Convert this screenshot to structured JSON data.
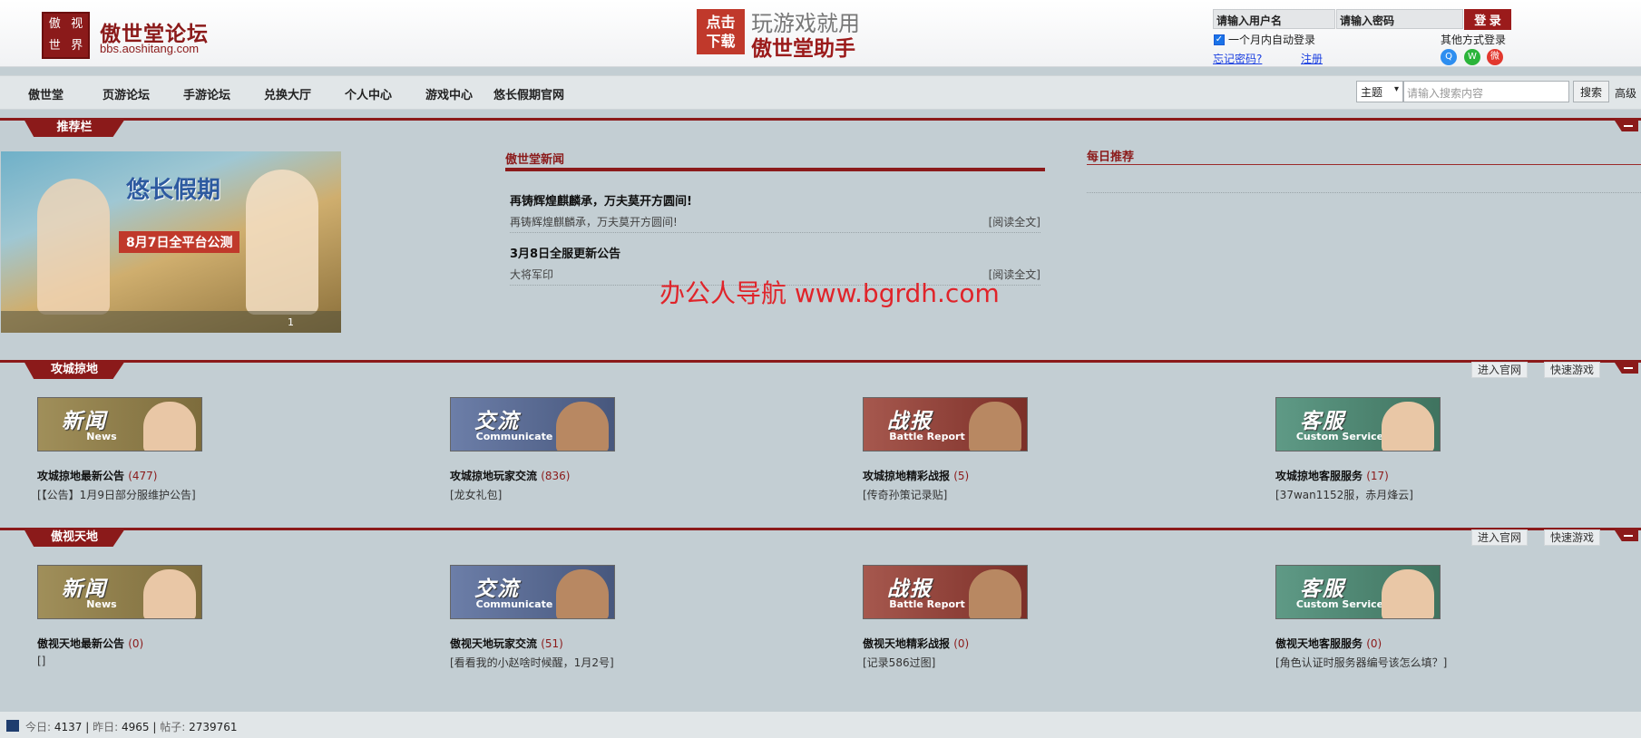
{
  "header": {
    "logo_chars": [
      "傲",
      "视",
      "世",
      "界"
    ],
    "site_name": "傲世堂论坛",
    "site_url": "bbs.aoshitang.com",
    "promo_badge": "点击下载",
    "promo_line1": "玩游戏就用",
    "promo_line2": "傲世堂助手"
  },
  "login": {
    "username_placeholder": "请输入用户名",
    "password_placeholder": "请输入密码",
    "login_button": "登 录",
    "remember_label": "一个月内自动登录",
    "forgot_link": "忘记密码?",
    "register_link": "注册",
    "other_login_label": "其他方式登录"
  },
  "nav": {
    "items": [
      "傲世堂",
      "页游论坛",
      "手游论坛",
      "兑换大厅",
      "个人中心",
      "游戏中心",
      "悠长假期官网"
    ],
    "search_type": "主题",
    "search_placeholder": "请输入搜索内容",
    "search_button": "搜索",
    "advanced": "高级"
  },
  "recommend": {
    "tab": "推荐栏",
    "banner_title": "悠长假期",
    "banner_date": "8月7日全平台公测",
    "banner_index": "1",
    "news_heading": "傲世堂新闻",
    "news": [
      {
        "title": "再铸辉煌麒麟承，万夫莫开方圆间!",
        "summary": "再铸辉煌麒麟承，万夫莫开方圆间!",
        "read_more": "[阅读全文]"
      },
      {
        "title": "3月8日全服更新公告",
        "summary": "大将军印",
        "read_more": "[阅读全文]"
      }
    ],
    "daily_heading": "每日推荐"
  },
  "watermark": "办公人导航  www.bgrdh.com",
  "sections": [
    {
      "tab": "攻城掠地",
      "links": [
        "进入官网",
        "快速游戏"
      ],
      "forums": [
        {
          "block_cn": "新闻",
          "block_en": "News",
          "title": "攻城掠地最新公告",
          "count": "(477)",
          "last": "[【公告】1月9日部分服维护公告]"
        },
        {
          "block_cn": "交流",
          "block_en": "Communicate",
          "title": "攻城掠地玩家交流",
          "count": "(836)",
          "last": "[龙女礼包]"
        },
        {
          "block_cn": "战报",
          "block_en": "Battle Report",
          "title": "攻城掠地精彩战报",
          "count": "(5)",
          "last": "[传奇孙策记录贴]"
        },
        {
          "block_cn": "客服",
          "block_en": "Custom Service",
          "title": "攻城掠地客服服务",
          "count": "(17)",
          "last": "[37wan1152服，赤月烽云]"
        }
      ]
    },
    {
      "tab": "傲视天地",
      "links": [
        "进入官网",
        "快速游戏"
      ],
      "forums": [
        {
          "block_cn": "新闻",
          "block_en": "News",
          "title": "傲视天地最新公告",
          "count": "(0)",
          "last": "[]"
        },
        {
          "block_cn": "交流",
          "block_en": "Communicate",
          "title": "傲视天地玩家交流",
          "count": "(51)",
          "last": "[看看我的小赵啥时候醒，1月2号]"
        },
        {
          "block_cn": "战报",
          "block_en": "Battle Report",
          "title": "傲视天地精彩战报",
          "count": "(0)",
          "last": "[记录586过图]"
        },
        {
          "block_cn": "客服",
          "block_en": "Custom Service",
          "title": "傲视天地客服服务",
          "count": "(0)",
          "last": "[角色认证时服务器编号该怎么填？]"
        }
      ]
    }
  ],
  "footer": {
    "today_label": "今日:",
    "today": "4137",
    "yesterday_label": "昨日:",
    "yesterday": "4965",
    "posts_label": "帖子:",
    "posts": "2739761",
    "sep": "|"
  },
  "colors": {
    "brand": "#8b1a1a",
    "page_bg": "#c3ced3",
    "link": "#1a3fe0"
  },
  "icons": [
    "qq-icon",
    "wechat-icon",
    "weibo-icon",
    "stats-icon",
    "collapse-icon"
  ]
}
